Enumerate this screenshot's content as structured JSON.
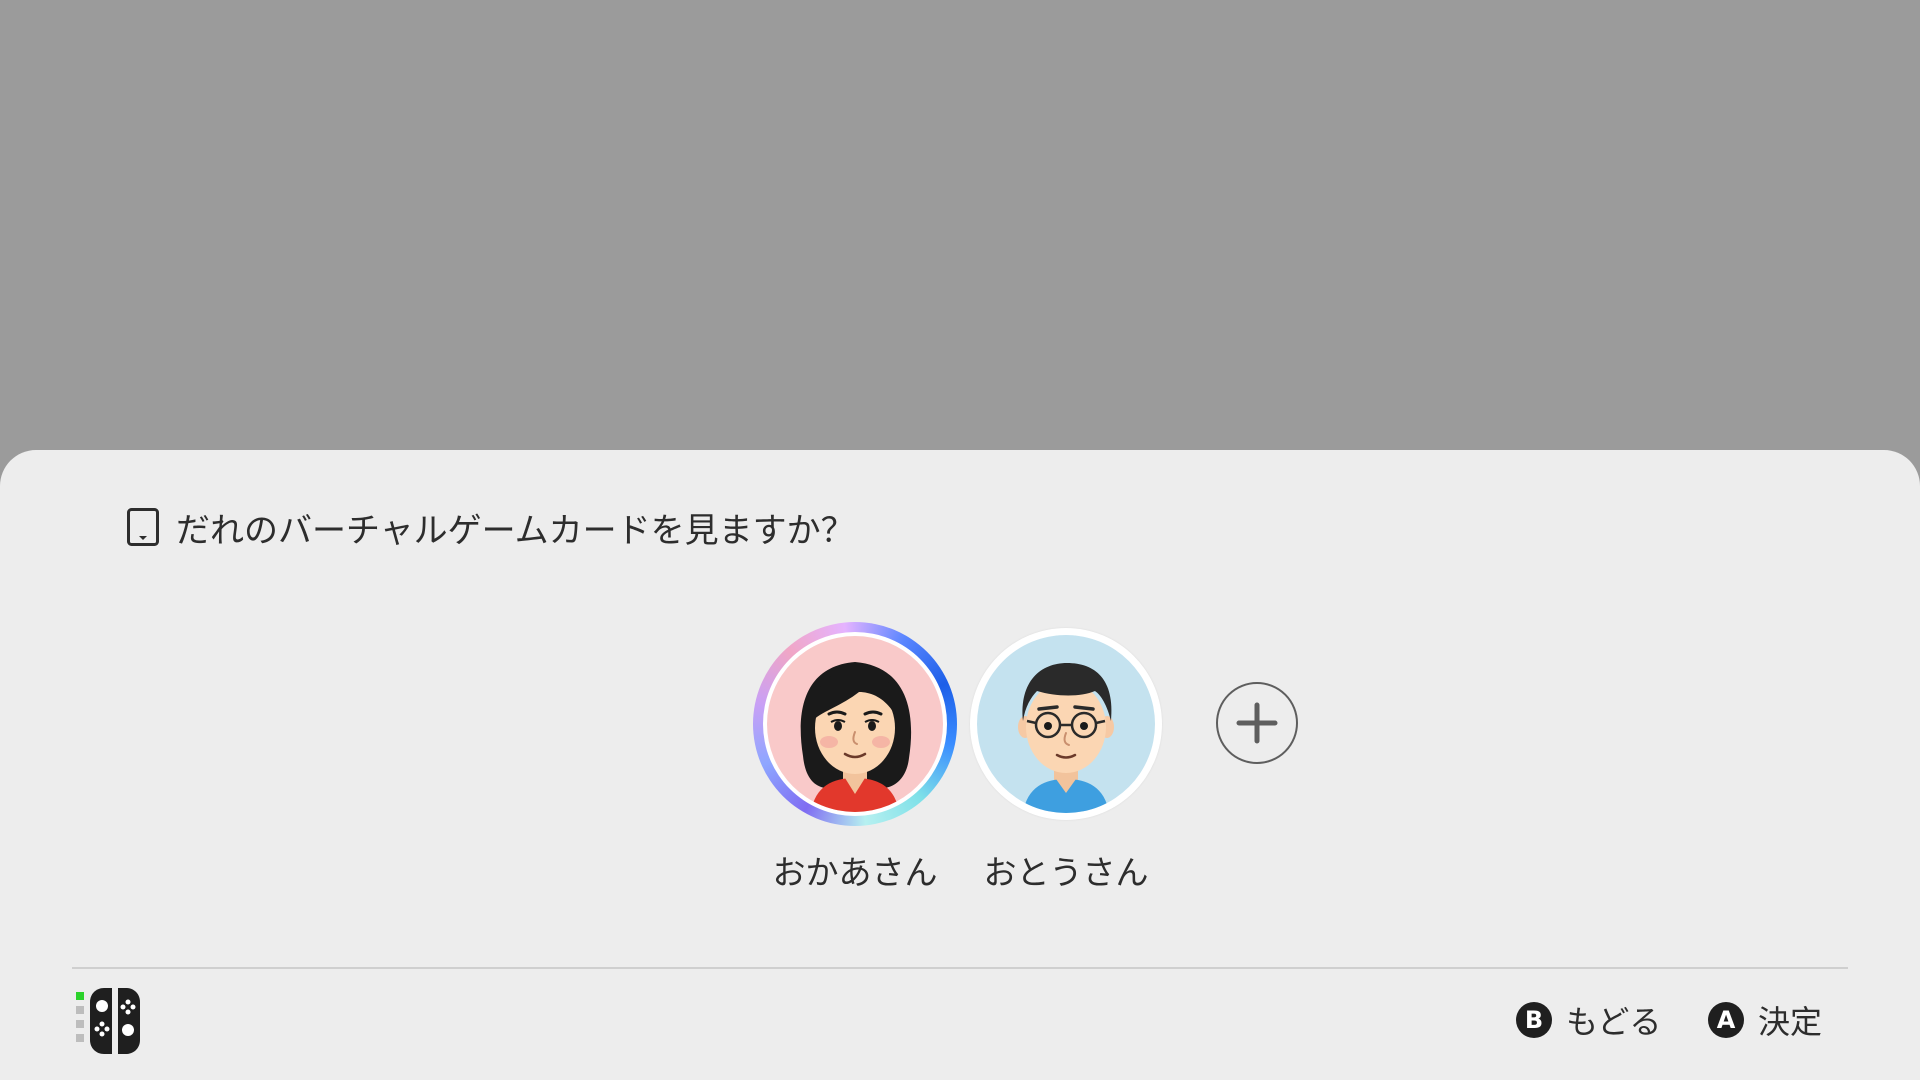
{
  "dialog": {
    "prompt_icon": "game-card-icon",
    "prompt": "だれのバーチャルゲームカードを見ますか？"
  },
  "users": [
    {
      "name": "おかあさん",
      "selected": true,
      "bg_color": "#f9c9c9",
      "shirt_color": "#e2382c"
    },
    {
      "name": "おとうさん",
      "selected": false,
      "bg_color": "#c4e2ef",
      "shirt_color": "#3e9fe0"
    }
  ],
  "add_user": {
    "icon": "plus-icon"
  },
  "controller": {
    "icon": "joycon-pair-icon",
    "player_indicator_color": "#2bd22b"
  },
  "hints": {
    "back": {
      "badge": "B",
      "label": "もどる"
    },
    "confirm": {
      "badge": "A",
      "label": "決定"
    }
  },
  "colors": {
    "backdrop": "#9b9b9b",
    "sheet": "#ededed",
    "accent_ring": "#1d5fe8"
  }
}
